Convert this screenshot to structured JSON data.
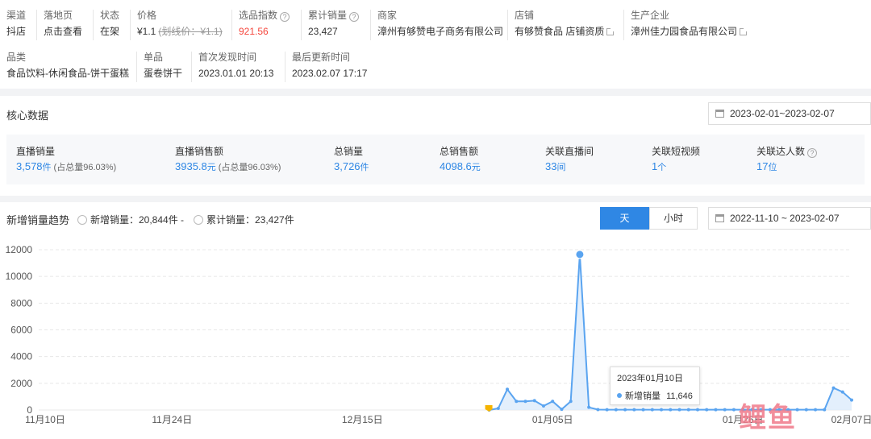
{
  "info": {
    "row1": [
      {
        "label": "渠道",
        "value": "抖店"
      },
      {
        "label": "落地页",
        "value": "点击查看"
      },
      {
        "label": "状态",
        "value": "在架"
      },
      {
        "label": "价格",
        "value": "¥1.1",
        "strike": "(划线价：¥1.1)"
      },
      {
        "label": "选品指数",
        "value": "921.56"
      },
      {
        "label": "累计销量",
        "value": "23,427"
      },
      {
        "label": "商家",
        "value": "漳州有够赞电子商务有限公司"
      },
      {
        "label": "店铺",
        "value": "有够赞食品 店铺资质"
      },
      {
        "label": "生产企业",
        "value": "漳州佳力园食品有限公司"
      }
    ],
    "row2": [
      {
        "label": "品类",
        "value": "食品饮料-休闲食品-饼干蛋糕"
      },
      {
        "label": "单品",
        "value": "蛋卷饼干"
      },
      {
        "label": "首次发现时间",
        "value": "2023.01.01 20:13"
      },
      {
        "label": "最后更新时间",
        "value": "2023.02.07 17:17"
      }
    ]
  },
  "core": {
    "title": "核心数据",
    "date_range": "2023-02-01~2023-02-07",
    "metrics": [
      {
        "label": "直播销量",
        "value": "3,578",
        "unit": "件",
        "sub": "(占总量96.03%)"
      },
      {
        "label": "直播销售额",
        "value": "3935.8",
        "unit": "元",
        "sub": "(占总量96.03%)"
      },
      {
        "label": "总销量",
        "value": "3,726",
        "unit": "件"
      },
      {
        "label": "总销售额",
        "value": "4098.6",
        "unit": "元"
      },
      {
        "label": "关联直播间",
        "value": "33",
        "unit": "间"
      },
      {
        "label": "关联短视频",
        "value": "1",
        "unit": "个"
      },
      {
        "label": "关联达人数",
        "value": "17",
        "unit": "位"
      }
    ]
  },
  "trend": {
    "title": "新增销量趋势",
    "legend_new": "新增销量：20,844件 -",
    "legend_total": "累计销量：23,427件",
    "toggle_day": "天",
    "toggle_hour": "小时",
    "date_range": "2022-11-10 ~ 2023-02-07",
    "tooltip_date": "2023年01月10日",
    "tooltip_series": "新增销量",
    "tooltip_value": "11,646",
    "watermark": "鲤鱼"
  },
  "colors": {
    "accent": "#2f87e4",
    "line": "#5aa4f0",
    "area": "#dcebfb",
    "red": "#f5463c"
  },
  "chart_data": {
    "type": "area",
    "ylim": [
      0,
      12000
    ],
    "yticks": [
      "0",
      "2000",
      "4000",
      "6000",
      "8000",
      "10000",
      "12000"
    ],
    "xticks": [
      "11月10日",
      "11月24日",
      "12月15日",
      "01月05日",
      "01月26日",
      "02月07日"
    ],
    "series": [
      {
        "name": "新增销量",
        "x": [
          "2022-12-29",
          "2022-12-30",
          "2022-12-31",
          "2023-01-01",
          "2023-01-02",
          "2023-01-03",
          "2023-01-04",
          "2023-01-05",
          "2023-01-06",
          "2023-01-07",
          "2023-01-08",
          "2023-01-09",
          "2023-01-10",
          "2023-01-11",
          "2023-01-12",
          "2023-01-13",
          "2023-01-14",
          "2023-01-15",
          "2023-01-16",
          "2023-01-17",
          "2023-01-18",
          "2023-01-19",
          "2023-01-20",
          "2023-01-21",
          "2023-01-22",
          "2023-01-23",
          "2023-01-24",
          "2023-01-25",
          "2023-01-26",
          "2023-01-27",
          "2023-01-28",
          "2023-01-29",
          "2023-01-30",
          "2023-01-31",
          "2023-02-01",
          "2023-02-02",
          "2023-02-03",
          "2023-02-04",
          "2023-02-05",
          "2023-02-06",
          "2023-02-07"
        ],
        "values": [
          0,
          120,
          1550,
          650,
          650,
          700,
          300,
          650,
          50,
          650,
          11646,
          200,
          30,
          20,
          20,
          20,
          20,
          20,
          20,
          20,
          20,
          20,
          20,
          20,
          20,
          20,
          20,
          20,
          20,
          20,
          20,
          20,
          20,
          20,
          20,
          20,
          20,
          20,
          1650,
          1350,
          750
        ]
      }
    ]
  }
}
